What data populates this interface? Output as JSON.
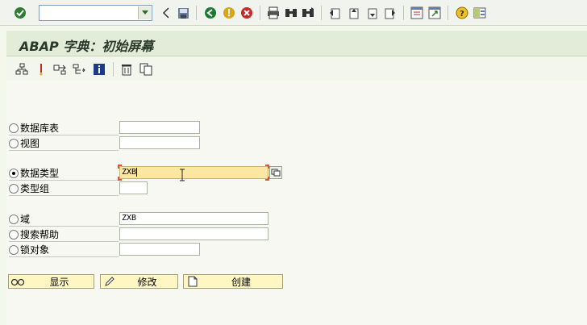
{
  "toolbar": {
    "command_value": ""
  },
  "title": {
    "text": "ABAP 字典：初始屏幕"
  },
  "form": {
    "rows": [
      {
        "label": "数据库表",
        "value": "",
        "selected": false
      },
      {
        "label": "视图",
        "value": "",
        "selected": false
      },
      {
        "label": "数据类型",
        "value": "ZXB",
        "selected": true
      },
      {
        "label": "类型组",
        "value": "",
        "selected": false
      },
      {
        "label": "域",
        "value": "ZXB",
        "selected": false
      },
      {
        "label": "搜索帮助",
        "value": "",
        "selected": false
      },
      {
        "label": "锁对象",
        "value": "",
        "selected": false
      }
    ]
  },
  "buttons": {
    "display": "显示",
    "change": "修改",
    "create": "创建"
  },
  "colors": {
    "title_bg": "#e3ecd8",
    "active_field": "#fbe6a2",
    "button_bg": "#fff6c4"
  }
}
